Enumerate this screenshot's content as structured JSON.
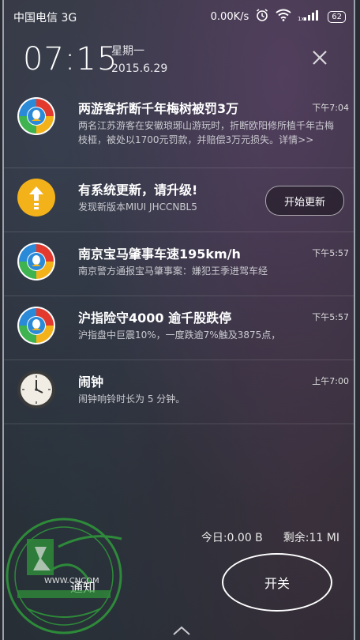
{
  "status": {
    "carrier": "中国电信 3G",
    "speed": "0.00K/s",
    "battery": "62"
  },
  "clock": {
    "time": "07:15",
    "weekday": "星期一",
    "date": "2015.6.29"
  },
  "notifications": [
    {
      "app_icon": "tencent-news-icon",
      "title": "两游客折断千年梅树被罚3万",
      "time": "下午7:04",
      "body": "两名江苏游客在安徽琅琊山游玩时，折断欧阳修所植千年古梅枝桠，被处以1700元罚款，并赔偿3万元损失。详情>>"
    },
    {
      "app_icon": "system-update-icon",
      "title": "有系统更新，请升级!",
      "time": "",
      "body": "发现新版本MIUI JHCCNBL5",
      "action_label": "开始更新"
    },
    {
      "app_icon": "tencent-news-icon",
      "title": "南京宝马肇事车速195km/h",
      "time": "下午5:57",
      "body": "南京警方通报宝马肇事案：嫌犯王季进驾车经"
    },
    {
      "app_icon": "tencent-news-icon",
      "title": "沪指险守4000 逾千股跌停",
      "time": "下午5:57",
      "body": "沪指盘中巨震10%，一度跌逾7%触及3875点，"
    },
    {
      "app_icon": "alarm-clock-icon",
      "title": "闹钟",
      "time": "上午7:00",
      "body": "闹钟响铃时长为 5 分钟。"
    }
  ],
  "bottom": {
    "today_usage": "今日:0.00 B",
    "remaining": "剩余:11 MI",
    "tab_notify": "通知",
    "tab_switch": "开关"
  },
  "watermark_text": "WWW.CNCOM",
  "colors": {
    "update_icon": "#f4b21a",
    "news_red": "#e23a2e",
    "news_blue": "#2a8ad8"
  }
}
